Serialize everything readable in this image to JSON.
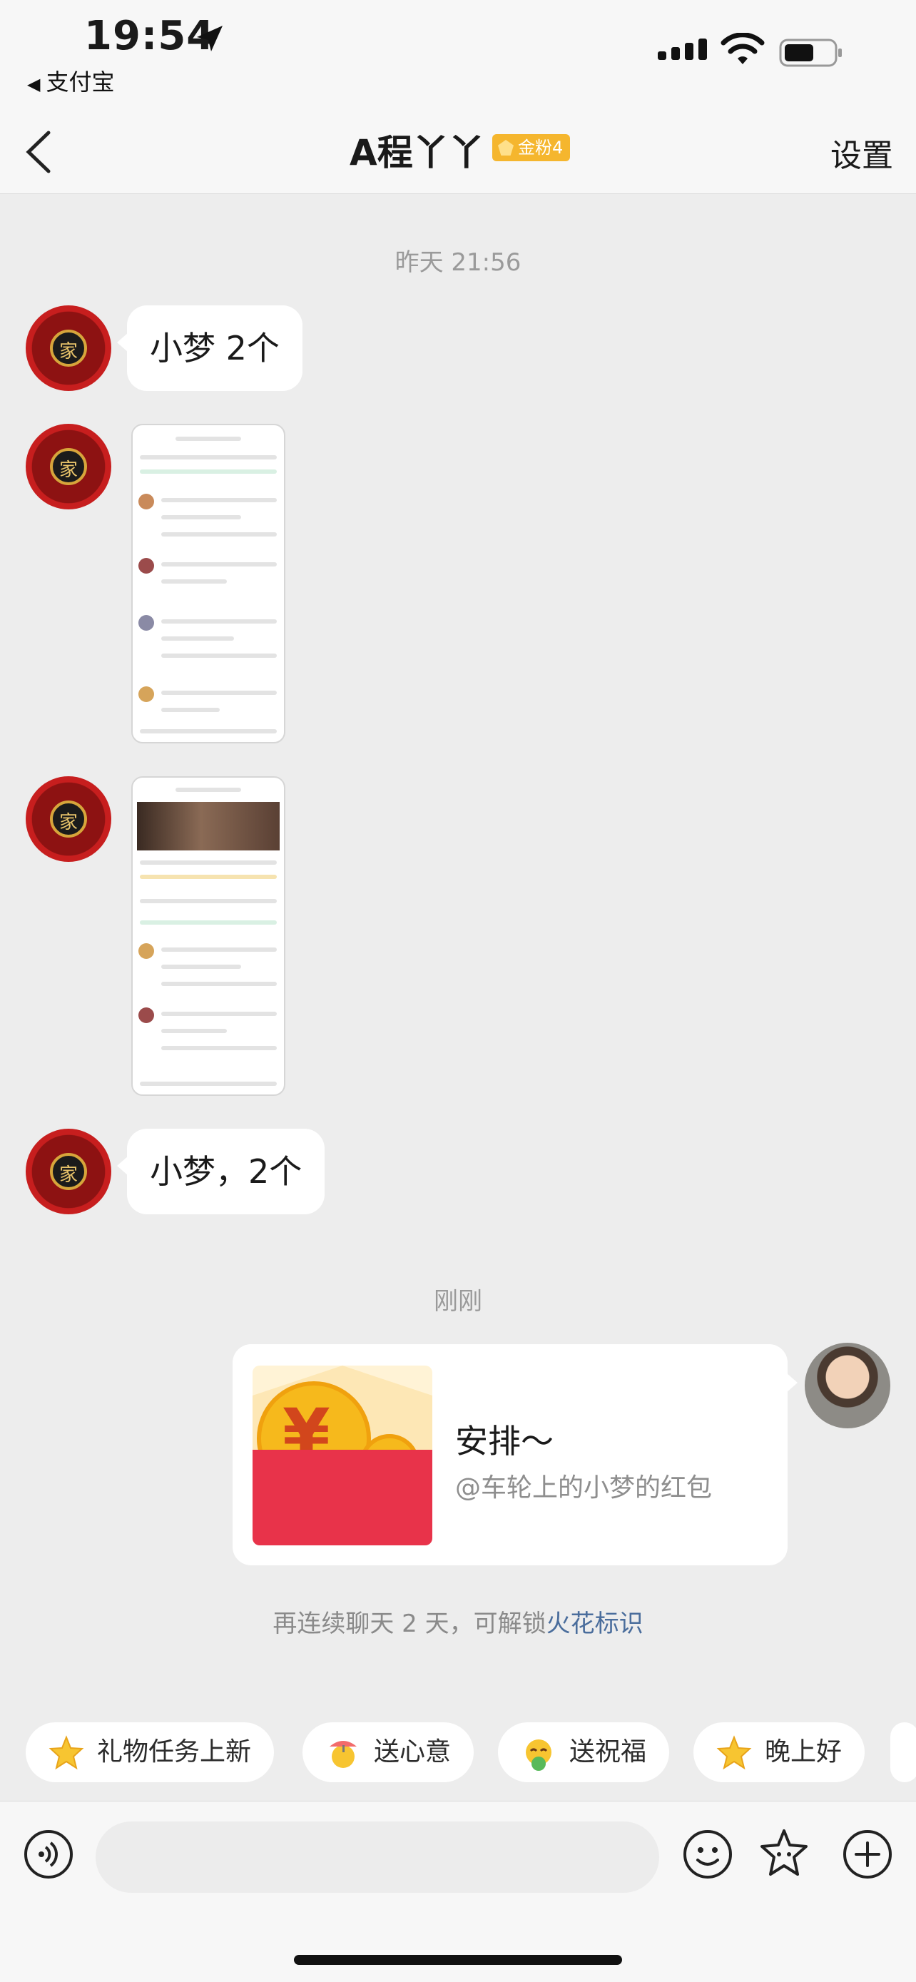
{
  "status_bar": {
    "time": "19:54",
    "back_app_label": "支付宝"
  },
  "nav": {
    "title": "A程丫丫",
    "badge": "金粉4",
    "settings": "设置"
  },
  "messages": {
    "timestamp_1": "昨天 21:56",
    "msg1": "小梦 2个",
    "msg4": "小梦，2个",
    "timestamp_2": "刚刚"
  },
  "red_packet": {
    "title": "安排～",
    "subtitle": "@车轮上的小梦的红包"
  },
  "hint": {
    "text": "再连续聊天 2 天，可解锁",
    "link": "火花标识"
  },
  "quick_replies": [
    {
      "label": "礼物任务上新",
      "icon": "star-icon"
    },
    {
      "label": "送心意",
      "icon": "beach-emoji-icon"
    },
    {
      "label": "送祝福",
      "icon": "blessing-emoji-icon"
    },
    {
      "label": "晚上好",
      "icon": "star-icon"
    }
  ],
  "colors": {
    "accent_link": "#4a6d9c",
    "badge": "#f5b62e",
    "red_packet": "#e8334a"
  }
}
